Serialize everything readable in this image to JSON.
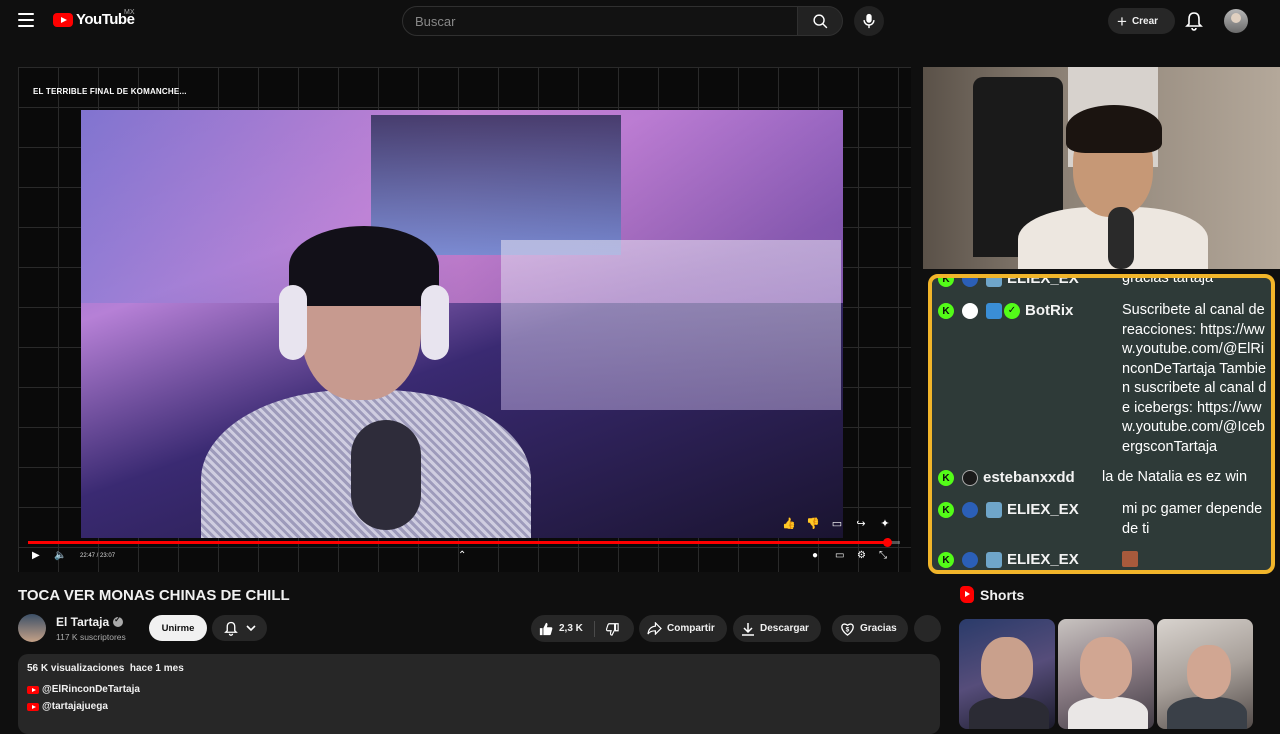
{
  "header": {
    "logo_text": "YouTube",
    "region": "MX",
    "search_placeholder": "Buscar",
    "create_label": "Crear"
  },
  "player": {
    "overlay_title": "EL TERRIBLE FINAL DE KOMANCHE...",
    "current_time": "22:47",
    "duration": "23:07",
    "time_display": "22:47 / 23:07",
    "progress": 0.9856
  },
  "chat": {
    "messages": [
      {
        "user": "ELIEX_EX",
        "text": "gracias tartaja"
      },
      {
        "user": "BotRix",
        "text": "Suscribete al canal de reacciones: https://www.youtube.com/@ElRinconDeTartaja Tambien suscribete al canal de icebergs: https://www.youtube.com/@IcebergsconTartaja"
      },
      {
        "user": "estebanxxdd",
        "text": "la de Natalia es ez win"
      },
      {
        "user": "ELIEX_EX",
        "text": "mi pc gamer depende de ti"
      },
      {
        "user": "ELIEX_EX",
        "text": ""
      }
    ],
    "kick_badge": "K"
  },
  "video": {
    "title": "TOCA VER MONAS CHINAS DE CHILL",
    "channel": "El Tartaja",
    "subscribers": "117 K suscriptores",
    "join_label": "Unirme",
    "likes": "2,3 K",
    "share_label": "Compartir",
    "download_label": "Descargar",
    "thanks_label": "Gracias"
  },
  "description": {
    "views": "56 K visualizaciones",
    "age": "hace 1 mes",
    "links": [
      "@ElRinconDeTartaja",
      "@tartajajuega"
    ]
  },
  "shorts": {
    "heading": "Shorts"
  },
  "colors": {
    "accent": "#ff0000",
    "chat_border": "#f1b52a",
    "kick_green": "#53fc18"
  }
}
